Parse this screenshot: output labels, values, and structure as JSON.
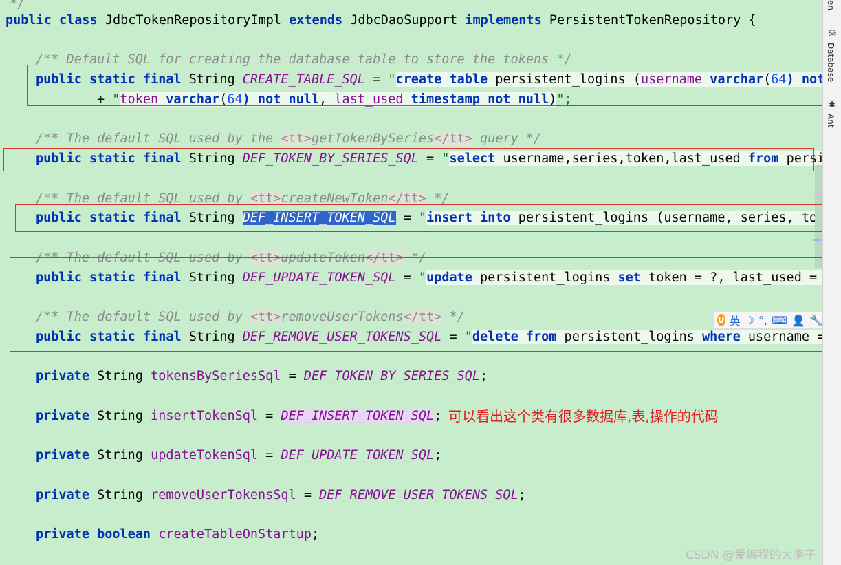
{
  "code": {
    "class_decl": {
      "kw1": "public",
      "kw2": "class",
      "name": "JdbcTokenRepositoryImpl",
      "kw3": "extends",
      "super": "JdbcDaoSupport",
      "kw4": "implements",
      "iface": "PersistentTokenRepository",
      "brace": "{"
    },
    "comment_create": "/** Default SQL for creating the database table to store the tokens */",
    "create_line1": {
      "mods": "public static final",
      "type": "String",
      "name": "CREATE_TABLE_SQL",
      "eq": " = ",
      "q": "\"",
      "s1": "create table",
      "s2": " persistent_logins (",
      "s3": "username",
      "s4": " varchar",
      "s5": "(",
      "s6": "64",
      "s7": ") not n"
    },
    "create_line2": {
      "plus": "+ ",
      "q": "\"",
      "s1": "token",
      "s2": " varchar",
      "s3": "(",
      "s4": "64",
      "s5": ") not null",
      "s6": ", ",
      "s7": "last_used",
      "s8": " timestamp not null",
      "s9": ")",
      "end": "\";"
    },
    "comment_series": {
      "pre": "/** The default SQL used by the ",
      "open": "<tt>",
      "mid": "getTokenBySeries",
      "close": "</tt>",
      "post": " query */"
    },
    "series_line": {
      "mods": "public static final",
      "type": "String",
      "name": "DEF_TOKEN_BY_SERIES_SQL",
      "eq": " = ",
      "q": "\"",
      "s1": "select",
      "s2": " username,series,token,last_used ",
      "s3": "from",
      "s4": " persis"
    },
    "comment_insert": {
      "pre": "/** The default SQL used by ",
      "open": "<tt>",
      "mid": "createNewToken",
      "close": "</tt>",
      "post": " */"
    },
    "insert_line": {
      "mods": "public static final",
      "type": "String",
      "name": "DEF_INSERT_TOKEN_SQL",
      "eq": " = ",
      "q": "\"",
      "s1": "insert into",
      "s2": " persistent_logins (username, series, toke"
    },
    "comment_update": {
      "pre": "/** The default SQL used by ",
      "open": "<tt>",
      "mid": "updateToken",
      "close": "</tt>",
      "post": " */"
    },
    "update_line": {
      "mods": "public static final",
      "type": "String",
      "name": "DEF_UPDATE_TOKEN_SQL",
      "eq": " = ",
      "q": "\"",
      "s1": "update",
      "s2": " persistent_logins ",
      "s3": "set",
      "s4": " token = ?, last_used = ?"
    },
    "comment_remove": {
      "pre": "/** The default SQL used by ",
      "open": "<tt>",
      "mid": "removeUserTokens",
      "close": "</tt>",
      "post": " */"
    },
    "remove_line": {
      "mods": "public static final",
      "type": "String",
      "name": "DEF_REMOVE_USER_TOKENS_SQL",
      "eq": " = ",
      "q": "\"",
      "s1": "delete from",
      "s2": " persistent_logins ",
      "s3": "where",
      "s4": " username = ?"
    },
    "field1": {
      "mod": "private",
      "type": "String",
      "name": "tokensBySeriesSql",
      "eq": " = ",
      "val": "DEF_TOKEN_BY_SERIES_SQL",
      "end": ";"
    },
    "field2": {
      "mod": "private",
      "type": "String",
      "name": "insertTokenSql",
      "eq": " = ",
      "val": "DEF_INSERT_TOKEN_SQL",
      "end": ";"
    },
    "field3": {
      "mod": "private",
      "type": "String",
      "name": "updateTokenSql",
      "eq": " = ",
      "val": "DEF_UPDATE_TOKEN_SQL",
      "end": ";"
    },
    "field4": {
      "mod": "private",
      "type": "String",
      "name": "removeUserTokensSql",
      "eq": " = ",
      "val": "DEF_REMOVE_USER_TOKENS_SQL",
      "end": ";"
    },
    "field5": {
      "mod": "private",
      "type": "boolean",
      "name": "createTableOnStartup",
      "end": ";"
    }
  },
  "annotation_note": "可以看出这个类有很多数据库,表,操作的代码",
  "sidebar": {
    "tab_top": "en",
    "tab_database": "Database",
    "tab_ant": "Ant"
  },
  "ime": {
    "lang": "英",
    "moon": "☽",
    "punct": "°,",
    "keyboard": "⌨",
    "user": "👤",
    "tool": "🔧"
  },
  "watermark": "CSDN @爱编程的大李子",
  "colors": {
    "keyword": "#0033b3",
    "constant": "#871094",
    "string": "#067d17",
    "comment": "#8c8c8c",
    "selection": "#2f65ca",
    "annotation_box": "#d9352e",
    "editor_bg": "#c7edcc"
  }
}
